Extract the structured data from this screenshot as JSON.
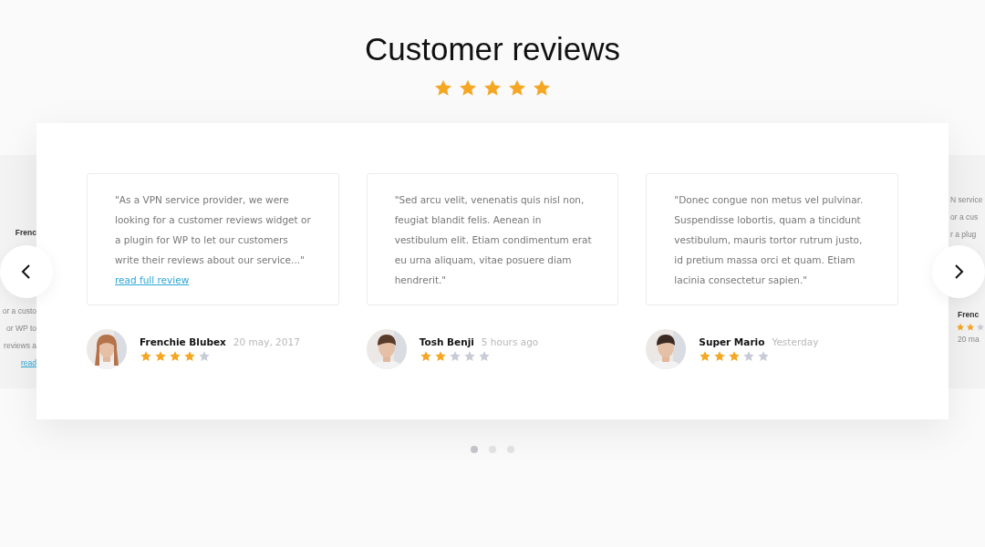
{
  "title": "Customer reviews",
  "overall": {
    "stars": 5
  },
  "left_peek": {
    "name": "Frenc",
    "lines": [
      "or a custo",
      "or WP to",
      "reviews a"
    ],
    "link": "read"
  },
  "right_peek": {
    "lines": [
      "N service",
      "or a cus",
      "r a plug"
    ],
    "name": "Frenc",
    "stars": 2,
    "date": "20 ma"
  },
  "reviews": [
    {
      "text": "\"As a VPN service provider, we were looking for a customer reviews widget or a plugin for WP to let our customers write their reviews about our service...\"",
      "link": "read full review",
      "name": "Frenchie Blubex",
      "date": "20 may, 2017",
      "stars": 4
    },
    {
      "text": "\"Sed arcu velit, venenatis quis nisl non, feugiat blandit felis. Aenean in vestibulum elit. Etiam condimentum erat eu urna aliquam, vitae posuere diam hendrerit.\"",
      "name": "Tosh Benji",
      "date": "5 hours ago",
      "stars": 2
    },
    {
      "text": "\"Donec congue non metus vel pulvinar. Suspendisse lobortis, quam a tincidunt vestibulum, mauris tortor rutrum justo, id pretium massa orci et quam. Etiam lacinia consectetur sapien.\"",
      "name": "Super Mario",
      "date": "Yesterday",
      "stars": 3
    }
  ],
  "pager": [
    {
      "selected": true
    },
    {
      "selected": false
    },
    {
      "selected": false
    }
  ]
}
